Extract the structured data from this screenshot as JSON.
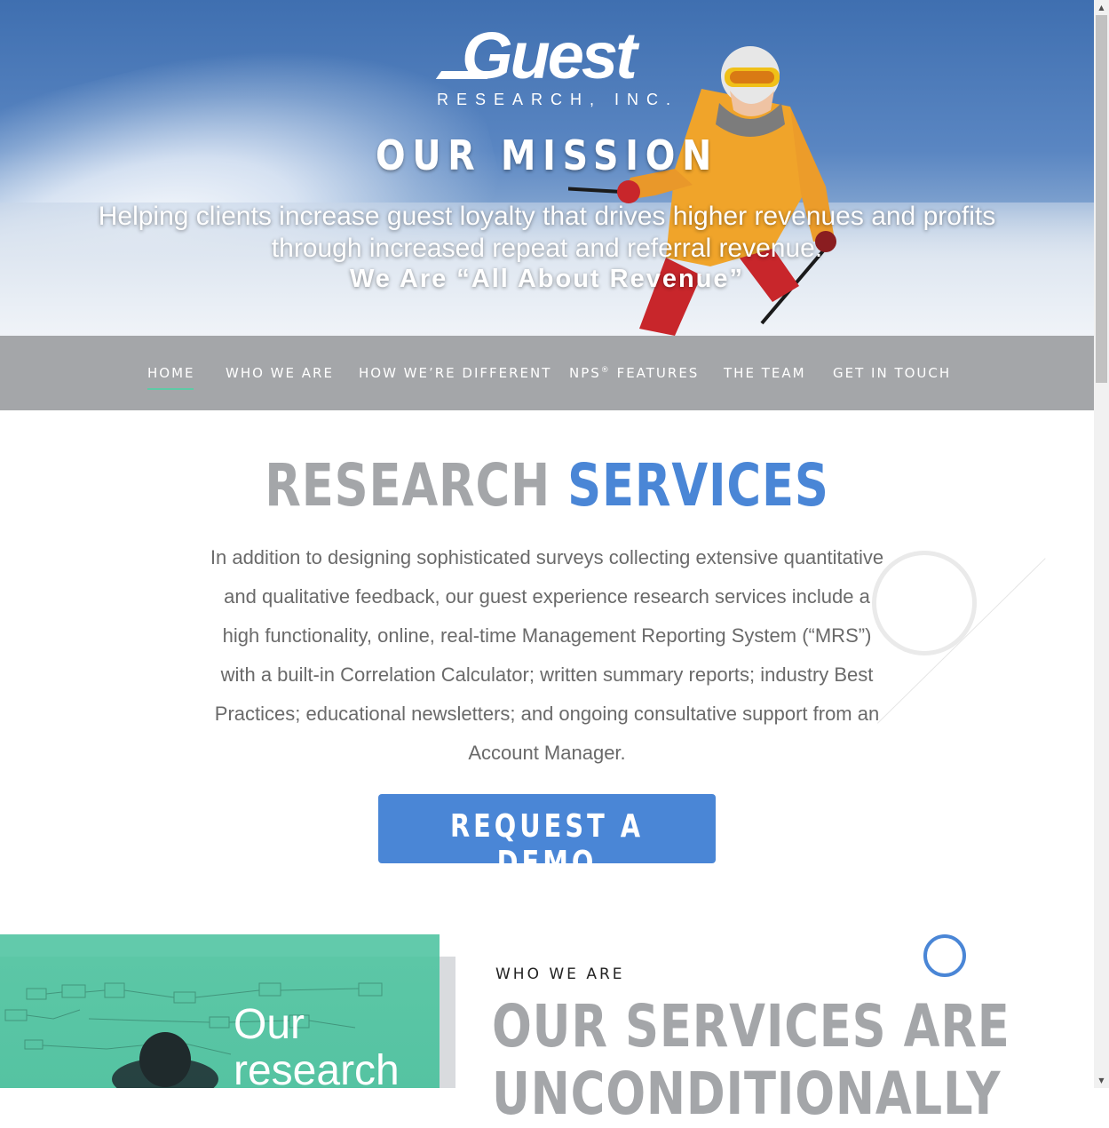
{
  "brand": {
    "logo_word": "Guest",
    "logo_sub": "RESEARCH, INC."
  },
  "hero": {
    "title": "OUR MISSION",
    "text": "Helping clients increase guest loyalty that drives higher revenues and profits through increased repeat and referral revenue.",
    "tagline": "We Are “All About Revenue”"
  },
  "nav": {
    "items": [
      {
        "label": "HOME",
        "active": true
      },
      {
        "label": "WHO WE ARE",
        "active": false
      },
      {
        "label": "HOW WE’RE DIFFERENT",
        "active": false
      },
      {
        "label": "NPS",
        "sup": "®",
        "label_after": " FEATURES",
        "active": false
      },
      {
        "label": "THE TEAM",
        "active": false
      },
      {
        "label": "GET IN TOUCH",
        "active": false
      }
    ]
  },
  "research_services": {
    "title_grey": "RESEARCH",
    "title_blue": "SERVICES",
    "body": "In addition to designing sophisticated surveys collecting extensive quantitative and qualitative feedback, our guest experience research services include a high functionality, online, real-time Management Reporting System (“MRS”) with a built-in Correlation Calculator; written summary reports; industry Best Practices; educational newsletters; and ongoing consultative support from an Account Manager.",
    "button_label": "REQUEST A DEMO"
  },
  "who_we_are": {
    "eyebrow": "WHO WE ARE",
    "heading_line1": "OUR SERVICES ARE",
    "heading_line2": "UNCONDITIONALLY",
    "image_text_line1": "Our",
    "image_text_line2": "research"
  },
  "colors": {
    "accent_blue": "#4a86d6",
    "nav_grey": "#a4a6a9",
    "teal": "#62caab",
    "active_underline": "#5ecaa6"
  },
  "scrollbar": {
    "up_icon": "triangle-up-icon",
    "down_icon": "triangle-down-icon"
  }
}
